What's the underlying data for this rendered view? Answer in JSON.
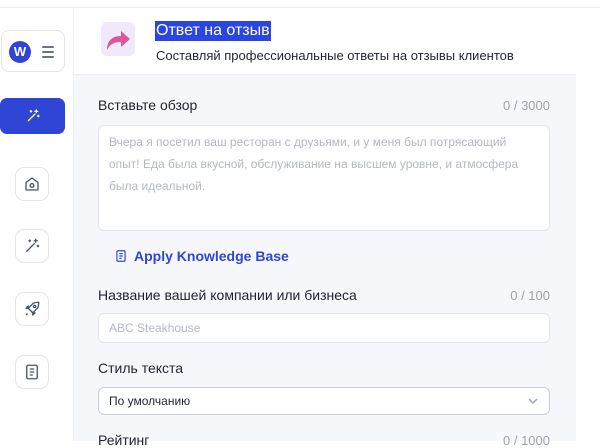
{
  "header": {
    "title": "Ответ на отзыв",
    "subtitle": "Составляй профессиональные ответы на отзывы клиентов"
  },
  "sidebar": {
    "brand_letter": "W",
    "items": [
      {
        "icon": "magic-wand-icon",
        "active": true
      },
      {
        "icon": "home-icon",
        "active": false
      },
      {
        "icon": "magic-wand-icon",
        "active": false
      },
      {
        "icon": "rocket-icon",
        "active": false
      },
      {
        "icon": "document-icon",
        "active": false
      }
    ]
  },
  "form": {
    "review": {
      "label": "Вставьте обзор",
      "counter": "0 / 3000",
      "placeholder": "Вчера я посетил ваш ресторан с друзьями, и у меня был потрясающий опыт! Еда была вкусной, обслуживание на высшем уровне, и атмосфера была идеальной."
    },
    "knowledge_base_link": "Apply Knowledge Base",
    "company": {
      "label": "Название вашей компании или бизнеса",
      "counter": "0 / 100",
      "placeholder": "ABC Steakhouse"
    },
    "style": {
      "label": "Стиль текста",
      "selected": "По умолчанию"
    },
    "rating": {
      "label": "Рейтинг",
      "counter": "0 / 1000"
    }
  },
  "colors": {
    "accent": "#2f45d3",
    "title_highlight": "#2b45e0",
    "background": "#f6f7fb"
  }
}
